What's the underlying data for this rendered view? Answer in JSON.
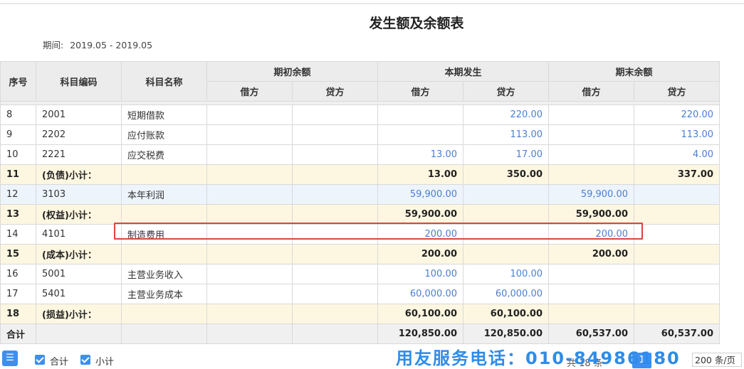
{
  "title": "发生额及余额表",
  "period": {
    "label": "期间:",
    "value": "2019.05 - 2019.05"
  },
  "headers": {
    "seq": "序号",
    "code": "科目编码",
    "name": "科目名称",
    "opening": "期初余额",
    "current": "本期发生",
    "closing": "期末余额",
    "debit": "借方",
    "credit": "贷方"
  },
  "rows": [
    {
      "seq": "8",
      "code": "2001",
      "name": "短期借款",
      "od": "",
      "oc": "",
      "cd": "",
      "cc": "220.00",
      "ed": "",
      "ec": "220.00",
      "type": "normal"
    },
    {
      "seq": "9",
      "code": "2202",
      "name": "应付账款",
      "od": "",
      "oc": "",
      "cd": "",
      "cc": "113.00",
      "ed": "",
      "ec": "113.00",
      "type": "normal"
    },
    {
      "seq": "10",
      "code": "2221",
      "name": "应交税费",
      "od": "",
      "oc": "",
      "cd": "13.00",
      "cc": "17.00",
      "ed": "",
      "ec": "4.00",
      "type": "normal"
    },
    {
      "seq": "11",
      "code": "(负债)小计：",
      "name": "",
      "od": "",
      "oc": "",
      "cd": "13.00",
      "cc": "350.00",
      "ed": "",
      "ec": "337.00",
      "type": "subtotal"
    },
    {
      "seq": "12",
      "code": "3103",
      "name": "本年利润",
      "od": "",
      "oc": "",
      "cd": "59,900.00",
      "cc": "",
      "ed": "59,900.00",
      "ec": "",
      "type": "highlight"
    },
    {
      "seq": "13",
      "code": "(权益)小计：",
      "name": "",
      "od": "",
      "oc": "",
      "cd": "59,900.00",
      "cc": "",
      "ed": "59,900.00",
      "ec": "",
      "type": "subtotal"
    },
    {
      "seq": "14",
      "code": "4101",
      "name": "制造费用",
      "od": "",
      "oc": "",
      "cd": "200.00",
      "cc": "",
      "ed": "200.00",
      "ec": "",
      "type": "normal"
    },
    {
      "seq": "15",
      "code": "(成本)小计：",
      "name": "",
      "od": "",
      "oc": "",
      "cd": "200.00",
      "cc": "",
      "ed": "200.00",
      "ec": "",
      "type": "subtotal"
    },
    {
      "seq": "16",
      "code": "5001",
      "name": "主营业务收入",
      "od": "",
      "oc": "",
      "cd": "100.00",
      "cc": "100.00",
      "ed": "",
      "ec": "",
      "type": "normal"
    },
    {
      "seq": "17",
      "code": "5401",
      "name": "主营业务成本",
      "od": "",
      "oc": "",
      "cd": "60,000.00",
      "cc": "60,000.00",
      "ed": "",
      "ec": "",
      "type": "normal"
    },
    {
      "seq": "18",
      "code": "(损益)小计：",
      "name": "",
      "od": "",
      "oc": "",
      "cd": "60,100.00",
      "cc": "60,100.00",
      "ed": "",
      "ec": "",
      "type": "subtotal"
    }
  ],
  "total": {
    "label": "合计",
    "od": "",
    "oc": "",
    "cd": "120,850.00",
    "cc": "120,850.00",
    "ed": "60,537.00",
    "ec": "60,537.00"
  },
  "footer": {
    "menu_icon": "list-menu-icon",
    "check_total_label": "合计",
    "check_subtotal_label": "小计",
    "hotline": "用友服务电话：010-84986180",
    "count_text": "共 18 条",
    "current_page": "1",
    "prev_arrow": "‹",
    "next_arrow": "›",
    "page_size": "200 条/页"
  },
  "colors": {
    "accent": "#3d8ff2",
    "amount_blue": "#4a7fd4",
    "subtotal_bg": "#fdf7e1",
    "highlight_box": "#e0443c"
  }
}
